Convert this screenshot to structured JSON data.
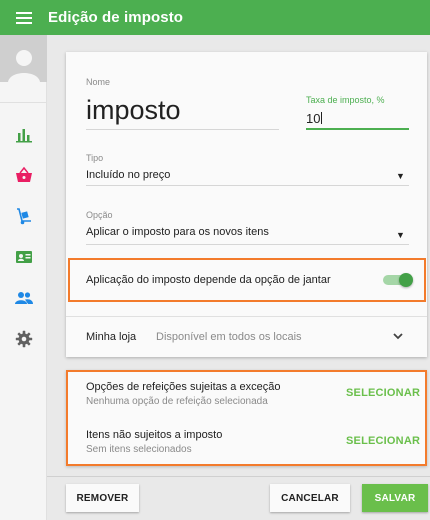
{
  "header": {
    "title": "Edição de imposto",
    "menu_icon": "menu-icon"
  },
  "sidebar": {
    "items": [
      {
        "icon": "bar-chart-icon",
        "color": "#43a047"
      },
      {
        "icon": "basket-icon",
        "color": "#e91e63"
      },
      {
        "icon": "hand-truck-icon",
        "color": "#1e88e5"
      },
      {
        "icon": "id-card-icon",
        "color": "#43a047"
      },
      {
        "icon": "people-icon",
        "color": "#1e88e5"
      },
      {
        "icon": "gear-icon",
        "color": "#616161"
      }
    ]
  },
  "form": {
    "name_label": "Nome",
    "name_value": "imposto",
    "rate_label": "Taxa de imposto, %",
    "rate_value": "10",
    "type_label": "Tipo",
    "type_value": "Incluído no preço",
    "option_label": "Opção",
    "option_value": "Aplicar o imposto para os novos itens",
    "dining_switch_label": "Aplicação do imposto depende da opção de jantar",
    "dining_switch_on": true,
    "store_label": "Minha loja",
    "store_value": "Disponível em todos os locais"
  },
  "options": {
    "dining": {
      "title": "Opções de refeições sujeitas a exceção",
      "subtitle": "Nenhuma opção de refeição selecionada",
      "button": "SELECIONAR"
    },
    "items": {
      "title": "Itens não sujeitos a imposto",
      "subtitle": "Sem itens selecionados",
      "button": "SELECIONAR"
    }
  },
  "footer": {
    "remove": "REMOVER",
    "cancel": "CANCELAR",
    "save": "SALVAR"
  },
  "colors": {
    "primary": "#4caf50",
    "accent_button": "#6abf4b",
    "highlight_border": "#f37b2c"
  }
}
